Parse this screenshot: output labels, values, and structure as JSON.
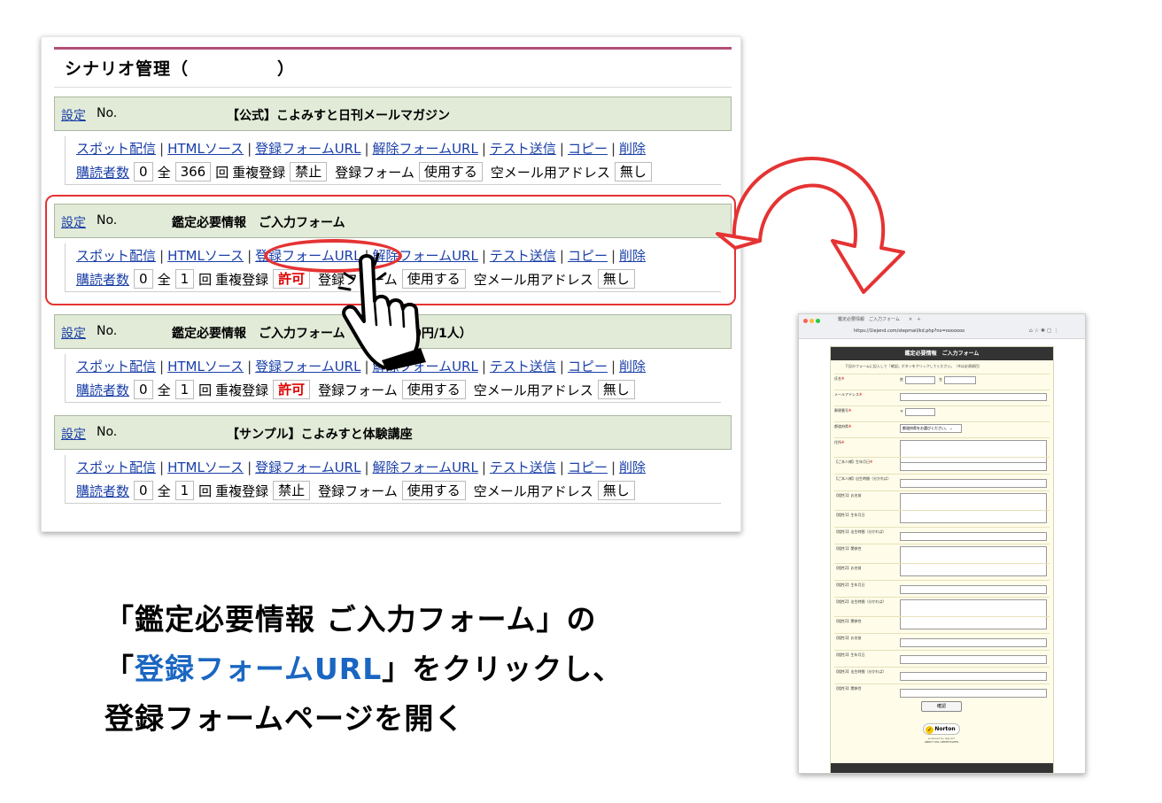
{
  "admin": {
    "title": "シナリオ管理（　　　　　）",
    "scenarios": [
      {
        "settings_link": "設定",
        "no_label": "No.",
        "name": "【公式】こよみすと日刊メールマガジン",
        "actions": [
          "スポット配信",
          "HTMLソース",
          "登録フォームURL",
          "解除フォームURL",
          "テスト送信",
          "コピー",
          "削除"
        ],
        "separator": "|",
        "subscribers_label": "購読者数",
        "subscribers_value": "0",
        "total_label": "全",
        "total_value": "366",
        "count_unit": "回",
        "duplicate_label": "重複登録",
        "duplicate_value": "禁止",
        "form_label": "登録フォーム",
        "form_value": "使用する",
        "empty_mail_label": "空メール用アドレス",
        "empty_mail_value": "無し"
      },
      {
        "settings_link": "設定",
        "no_label": "No.",
        "name": "鑑定必要情報　ご入力フォーム",
        "actions": [
          "スポット配信",
          "HTMLソース",
          "登録フォームURL",
          "解除フォームURL",
          "テスト送信",
          "コピー",
          "削除"
        ],
        "separator": "|",
        "subscribers_label": "購読者数",
        "subscribers_value": "0",
        "total_label": "全",
        "total_value": "1",
        "count_unit": "回",
        "duplicate_label": "重複登録",
        "duplicate_value": "許可",
        "form_label": "登録フォーム",
        "form_value": "使用する",
        "empty_mail_label": "空メール用アドレス",
        "empty_mail_value": "無し"
      },
      {
        "settings_link": "設定",
        "no_label": "No.",
        "name": "鑑定必要情報　ご入力フォーム（料金1,000円/1人）",
        "actions": [
          "スポット配信",
          "HTMLソース",
          "登録フォームURL",
          "解除フォームURL",
          "テスト送信",
          "コピー",
          "削除"
        ],
        "separator": "|",
        "subscribers_label": "購読者数",
        "subscribers_value": "0",
        "total_label": "全",
        "total_value": "1",
        "count_unit": "回",
        "duplicate_label": "重複登録",
        "duplicate_value": "許可",
        "form_label": "登録フォーム",
        "form_value": "使用する",
        "empty_mail_label": "空メール用アドレス",
        "empty_mail_value": "無し"
      },
      {
        "settings_link": "設定",
        "no_label": "No.",
        "name": "【サンプル】こよみすと体験講座",
        "actions": [
          "スポット配信",
          "HTMLソース",
          "登録フォームURL",
          "解除フォームURL",
          "テスト送信",
          "コピー",
          "削除"
        ],
        "separator": "|",
        "subscribers_label": "購読者数",
        "subscribers_value": "0",
        "total_label": "全",
        "total_value": "1",
        "count_unit": "回",
        "duplicate_label": "重複登録",
        "duplicate_value": "禁止",
        "form_label": "登録フォーム",
        "form_value": "使用する",
        "empty_mail_label": "空メール用アドレス",
        "empty_mail_value": "無し"
      }
    ]
  },
  "caption": {
    "line1": "「鑑定必要情報 ご入力フォーム」の",
    "line2_open": "「",
    "line2_highlight": "登録フォームURL",
    "line2_rest": "」をクリックし、",
    "line3": "登録フォームページを開く"
  },
  "form_page": {
    "tab_title": "鑑定必要情報　ご入力フォーム　　×　＋",
    "url": "https://1lejend.com/stepmail/kd.php?no=ooooooo",
    "browser_icons": "⌂ ☆ ✱ ▢ ⋮",
    "title": "鑑定必要情報　ご入力フォーム",
    "note": "下記のフォームに記入して「確認」ボタンをクリックしてください。（※は必須項目）",
    "fields": [
      {
        "label": "氏名",
        "required": true,
        "type": "name"
      },
      {
        "label": "メールアドレス",
        "required": true,
        "type": "text"
      },
      {
        "label": "郵便番号",
        "required": true,
        "type": "zip"
      },
      {
        "label": "都道府県",
        "required": true,
        "type": "select"
      },
      {
        "label": "住所",
        "required": true,
        "type": "textarea"
      },
      {
        "label": "【ご本人様】生年月日",
        "required": true,
        "type": "short"
      },
      {
        "label": "【ご本人様】出生時間（分かれば）",
        "required": false,
        "type": "short"
      },
      {
        "label": "【相性1】お名前",
        "required": false,
        "type": "textarea"
      },
      {
        "label": "【相性1】生年月日",
        "required": false,
        "type": "none"
      },
      {
        "label": "【相性1】出生時間（分かれば）",
        "required": false,
        "type": "short"
      },
      {
        "label": "【相性1】関係性",
        "required": false,
        "type": "textarea"
      },
      {
        "label": "【相性2】お名前",
        "required": false,
        "type": "none"
      },
      {
        "label": "【相性2】生年月日",
        "required": false,
        "type": "short"
      },
      {
        "label": "【相性2】出生時間（分かれば）",
        "required": false,
        "type": "textarea"
      },
      {
        "label": "【相性2】関係性",
        "required": false,
        "type": "none"
      },
      {
        "label": "【相性3】お名前",
        "required": false,
        "type": "short"
      },
      {
        "label": "【相性3】生年月日",
        "required": false,
        "type": "short"
      },
      {
        "label": "【相性3】出生時間（分かれば）",
        "required": false,
        "type": "short"
      },
      {
        "label": "【相性3】関係性",
        "required": false,
        "type": "short"
      }
    ],
    "name_last": "姓",
    "name_first": "名",
    "zip_mark": "〒",
    "select_value": "都道府県をお選びください。",
    "required_mark": "※",
    "confirm_button": "確認",
    "norton_badge": "Norton",
    "norton_check": "✓",
    "norton_powered": "powered by digicert",
    "norton_about": "ABOUT SSL CERTIFICATES"
  },
  "colors": {
    "accent_red": "#e53333",
    "link_blue": "#1a3fa8",
    "caption_blue": "#1a66c2",
    "header_green": "#e2ebd8",
    "title_pink": "#b34f79"
  }
}
